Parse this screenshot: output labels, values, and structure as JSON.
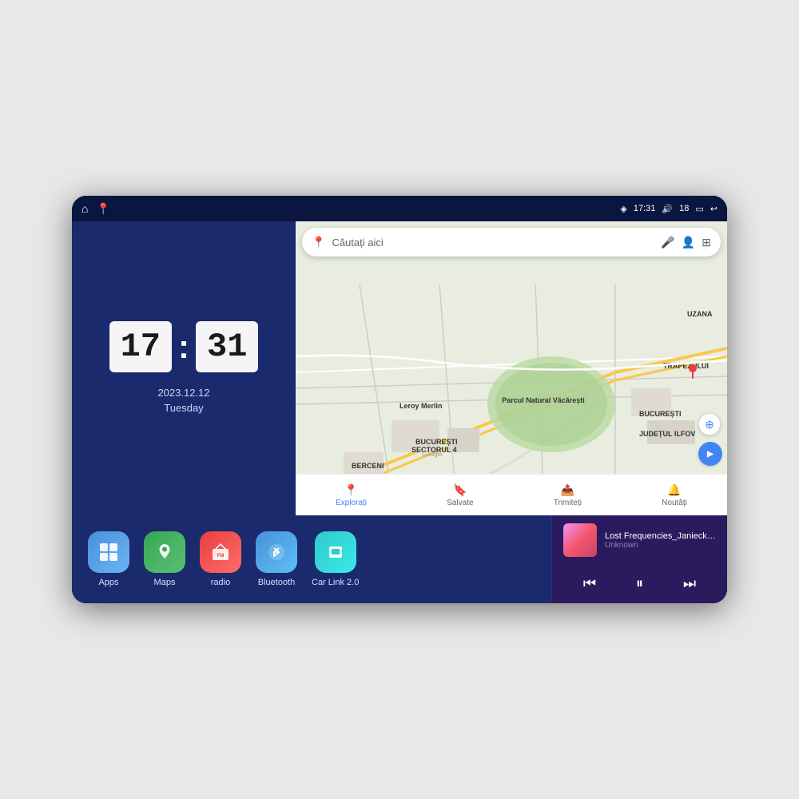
{
  "device": {
    "status_bar": {
      "left_icons": [
        "home",
        "maps-pin"
      ],
      "time": "17:31",
      "signal_icon": "signal",
      "volume": "18",
      "battery_icon": "battery",
      "back_icon": "back"
    }
  },
  "clock": {
    "hours": "17",
    "minutes": "31",
    "date": "2023.12.12",
    "day": "Tuesday"
  },
  "map": {
    "search_placeholder": "Căutați aici",
    "tabs": [
      {
        "label": "Explorați",
        "icon": "📍",
        "active": true
      },
      {
        "label": "Salvate",
        "icon": "🔖",
        "active": false
      },
      {
        "label": "Trimiteți",
        "icon": "📤",
        "active": false
      },
      {
        "label": "Noutăți",
        "icon": "🔔",
        "active": false
      }
    ],
    "place_label": "Parcul Natural Văcărești",
    "district_label": "BUCUREȘTI SECTORUL 4",
    "bucharest_label": "BUCUREȘTI",
    "ilfov_label": "JUDEȚUL ILFOV",
    "berceni_label": "BERCENI",
    "leroy_label": "Leroy Merlin",
    "trapezului_label": "TRAPEZULUI",
    "google_label": "Google"
  },
  "apps": [
    {
      "id": "apps",
      "label": "Apps",
      "icon": "⊞",
      "color_class": "app-icon-apps"
    },
    {
      "id": "maps",
      "label": "Maps",
      "icon": "📍",
      "color_class": "app-icon-maps"
    },
    {
      "id": "radio",
      "label": "radio",
      "icon": "📻",
      "color_class": "app-icon-radio"
    },
    {
      "id": "bluetooth",
      "label": "Bluetooth",
      "icon": "🔵",
      "color_class": "app-icon-bluetooth"
    },
    {
      "id": "carlink",
      "label": "Car Link 2.0",
      "icon": "📱",
      "color_class": "app-icon-carlink"
    }
  ],
  "music": {
    "title": "Lost Frequencies_Janieck Devy-...",
    "artist": "Unknown",
    "controls": {
      "prev": "⏮",
      "play_pause": "⏸",
      "next": "⏭"
    }
  }
}
